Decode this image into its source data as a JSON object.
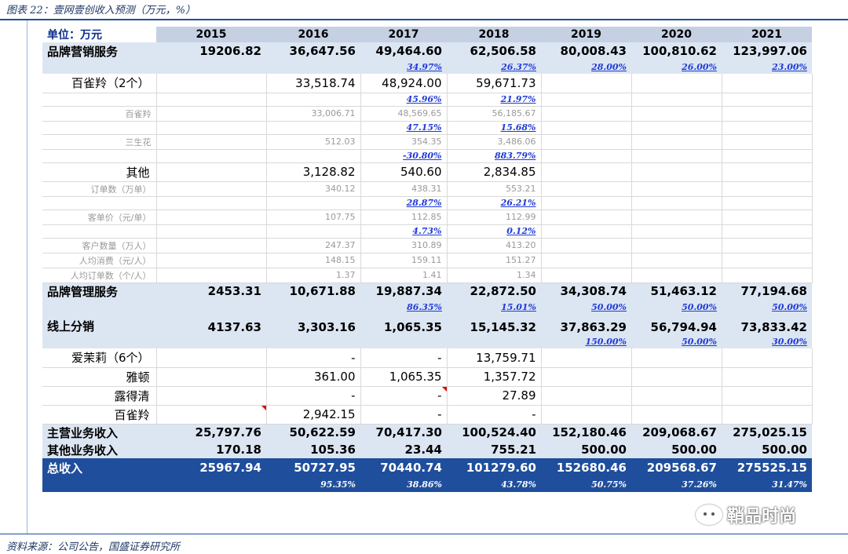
{
  "title": "图表 22：壹网壹创收入预测（万元，%）",
  "source": "资料来源：公司公告，国盛证券研究所",
  "watermark": "鞘品时尚",
  "header": {
    "unit": "单位：万元",
    "years": [
      "2015",
      "2016",
      "2017",
      "2018",
      "2019",
      "2020",
      "2021"
    ]
  },
  "rows": [
    {
      "type": "main",
      "label": "品牌营销服务",
      "values": [
        "19206.82",
        "36,647.56",
        "49,464.60",
        "62,506.58",
        "80,008.43",
        "100,810.62",
        "123,997.06"
      ]
    },
    {
      "type": "main-pct",
      "label": "",
      "values": [
        "",
        "",
        "34.97%",
        "26.37%",
        "28.00%",
        "26.00%",
        "23.00%"
      ]
    },
    {
      "type": "sub",
      "label": "百雀羚（2个）",
      "values": [
        "",
        "33,518.74",
        "48,924.00",
        "59,671.73",
        "",
        "",
        ""
      ]
    },
    {
      "type": "pct",
      "label": "",
      "values": [
        "",
        "",
        "45.96%",
        "21.97%",
        "",
        "",
        ""
      ]
    },
    {
      "type": "gray",
      "label": "百雀羚",
      "values": [
        "",
        "33,006.71",
        "48,569.65",
        "56,185.67",
        "",
        "",
        ""
      ]
    },
    {
      "type": "pct",
      "label": "",
      "values": [
        "",
        "",
        "47.15%",
        "15.68%",
        "",
        "",
        ""
      ]
    },
    {
      "type": "gray",
      "label": "三生花",
      "values": [
        "",
        "512.03",
        "354.35",
        "3,486.06",
        "",
        "",
        ""
      ]
    },
    {
      "type": "pct",
      "label": "",
      "values": [
        "",
        "",
        "-30.80%",
        "883.79%",
        "",
        "",
        ""
      ]
    },
    {
      "type": "sub",
      "label": "其他",
      "values": [
        "",
        "3,128.82",
        "540.60",
        "2,834.85",
        "",
        "",
        ""
      ]
    },
    {
      "type": "gray",
      "label": "订单数（万单）",
      "values": [
        "",
        "340.12",
        "438.31",
        "553.21",
        "",
        "",
        ""
      ]
    },
    {
      "type": "pct",
      "label": "",
      "values": [
        "",
        "",
        "28.87%",
        "26.21%",
        "",
        "",
        ""
      ]
    },
    {
      "type": "gray",
      "label": "客单价（元/单）",
      "values": [
        "",
        "107.75",
        "112.85",
        "112.99",
        "",
        "",
        ""
      ]
    },
    {
      "type": "pct",
      "label": "",
      "values": [
        "",
        "",
        "4.73%",
        "0.12%",
        "",
        "",
        ""
      ]
    },
    {
      "type": "gray",
      "label": "客户数量（万人）",
      "values": [
        "",
        "247.37",
        "310.89",
        "413.20",
        "",
        "",
        ""
      ]
    },
    {
      "type": "gray",
      "label": "人均消费（元/人）",
      "values": [
        "",
        "148.15",
        "159.11",
        "151.27",
        "",
        "",
        ""
      ]
    },
    {
      "type": "gray",
      "label": "人均订单数（个/人）",
      "values": [
        "",
        "1.37",
        "1.41",
        "1.34",
        "",
        "",
        ""
      ]
    },
    {
      "type": "main",
      "label": "品牌管理服务",
      "values": [
        "2453.31",
        "10,671.88",
        "19,887.34",
        "22,872.50",
        "34,308.74",
        "51,463.12",
        "77,194.68"
      ]
    },
    {
      "type": "main-pct",
      "label": "",
      "values": [
        "",
        "",
        "86.35%",
        "15.01%",
        "50.00%",
        "50.00%",
        "50.00%"
      ]
    },
    {
      "type": "main-tall",
      "label": "线上分销",
      "values": [
        "4137.63",
        "3,303.16",
        "1,065.35",
        "15,145.32",
        "37,863.29",
        "56,794.94",
        "73,833.42"
      ]
    },
    {
      "type": "main-pct",
      "label": "",
      "values": [
        "",
        "",
        "",
        "",
        "150.00%",
        "50.00%",
        "30.00%"
      ]
    },
    {
      "type": "sub",
      "label": "爱茉莉（6个）",
      "values": [
        "",
        "-",
        "-",
        "13,759.71",
        "",
        "",
        ""
      ]
    },
    {
      "type": "sub",
      "label": "雅顿",
      "values": [
        "",
        "361.00",
        "1,065.35",
        "1,357.72",
        "",
        "",
        ""
      ]
    },
    {
      "type": "sub",
      "label": "露得清",
      "values": [
        "",
        "-",
        "-",
        "27.89",
        "",
        "",
        ""
      ]
    },
    {
      "type": "sub",
      "label": "百雀羚",
      "values": [
        "",
        "2,942.15",
        "-",
        "-",
        "",
        "",
        ""
      ]
    },
    {
      "type": "main",
      "label": "主营业务收入",
      "values": [
        "25,797.76",
        "50,622.59",
        "70,417.30",
        "100,524.40",
        "152,180.46",
        "209,068.67",
        "275,025.15"
      ]
    },
    {
      "type": "main",
      "label": "其他业务收入",
      "values": [
        "170.18",
        "105.36",
        "23.44",
        "755.21",
        "500.00",
        "500.00",
        "500.00"
      ]
    },
    {
      "type": "total",
      "label": "总收入",
      "values": [
        "25967.94",
        "50727.95",
        "70440.74",
        "101279.60",
        "152680.46",
        "209568.67",
        "275525.15"
      ]
    },
    {
      "type": "total-pct",
      "label": "",
      "values": [
        "",
        "95.35%",
        "38.86%",
        "43.78%",
        "50.75%",
        "37.26%",
        "31.47%"
      ]
    }
  ]
}
